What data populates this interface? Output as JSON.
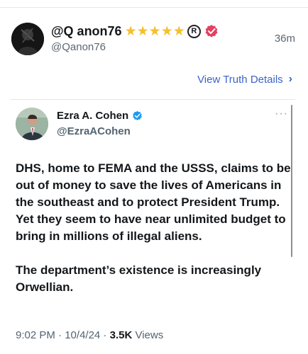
{
  "post": {
    "display_name": "@Q anon76",
    "star_count": 5,
    "star_glyph": "★",
    "reg_mark": "R",
    "handle": "@Qanon76",
    "time": "36m",
    "view_details": "View Truth Details",
    "view_details_chevron": "›"
  },
  "embedded_tweet": {
    "author_name": "Ezra A. Cohen",
    "author_handle": "@EzraACohen",
    "more": "···",
    "paragraphs": [
      "DHS, home to FEMA and the USSS, claims to be out of money to save the lives of Americans in the southeast and to protect President Trump. Yet they seem to have near unlimited budget to bring in millions of illegal aliens.",
      "The department’s existence is increasingly Orwellian."
    ],
    "time": "9:02 PM",
    "date": "10/4/24",
    "separator": " · ",
    "views_count": "3.5K",
    "views_label": "Views"
  },
  "colors": {
    "star": "#f5c02c",
    "pink_badge": "#e4405f",
    "blue_badge": "#1d9bf0",
    "link": "#3b63c9"
  },
  "icons": {
    "avatar": "dark-profile-photo",
    "author_avatar": "man-in-suit-photo",
    "verified_pink": "pink-check-badge-icon",
    "verified_blue": "blue-check-badge-icon"
  }
}
